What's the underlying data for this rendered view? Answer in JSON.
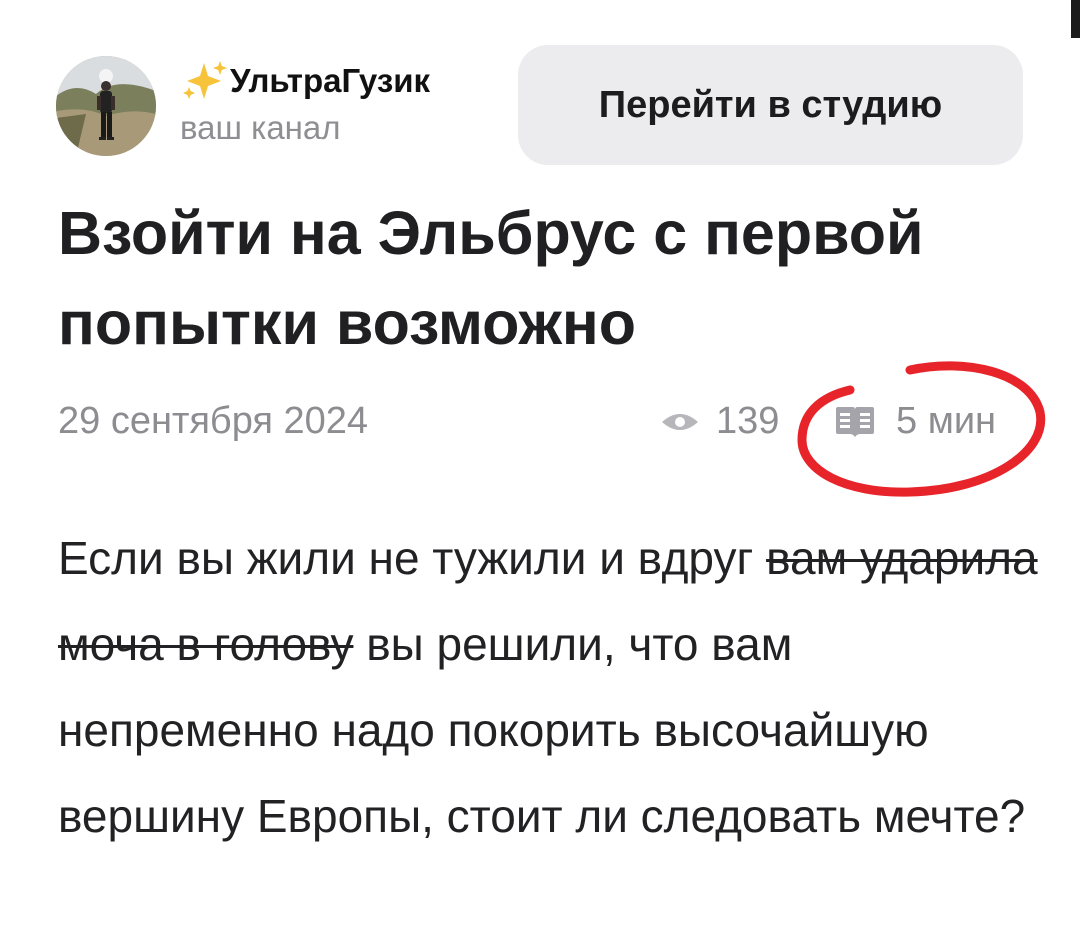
{
  "header": {
    "channel_name": "УльтраГузик",
    "channel_sub": "ваш канал",
    "studio_button_label": "Перейти в студию",
    "channel_icon": "sparkles-icon"
  },
  "article": {
    "title": "Взойти на Эльбрус с первой попытки возможно",
    "date": "29 сентября 2024",
    "views": "139",
    "read_time": "5 мин",
    "body_part1": "Если вы жили не тужили и вдруг ",
    "body_strikethrough": "вам ударила моча в голову",
    "body_part2": " вы решили, что вам непременно надо покорить высочайшую вершину Европы, стоит ли следовать мечте?"
  },
  "annotation": {
    "circle_color": "#e8242b",
    "circled_item": "read_time"
  },
  "colors": {
    "button_bg": "#ececef",
    "muted_text": "#8c8c91",
    "text": "#202022"
  }
}
